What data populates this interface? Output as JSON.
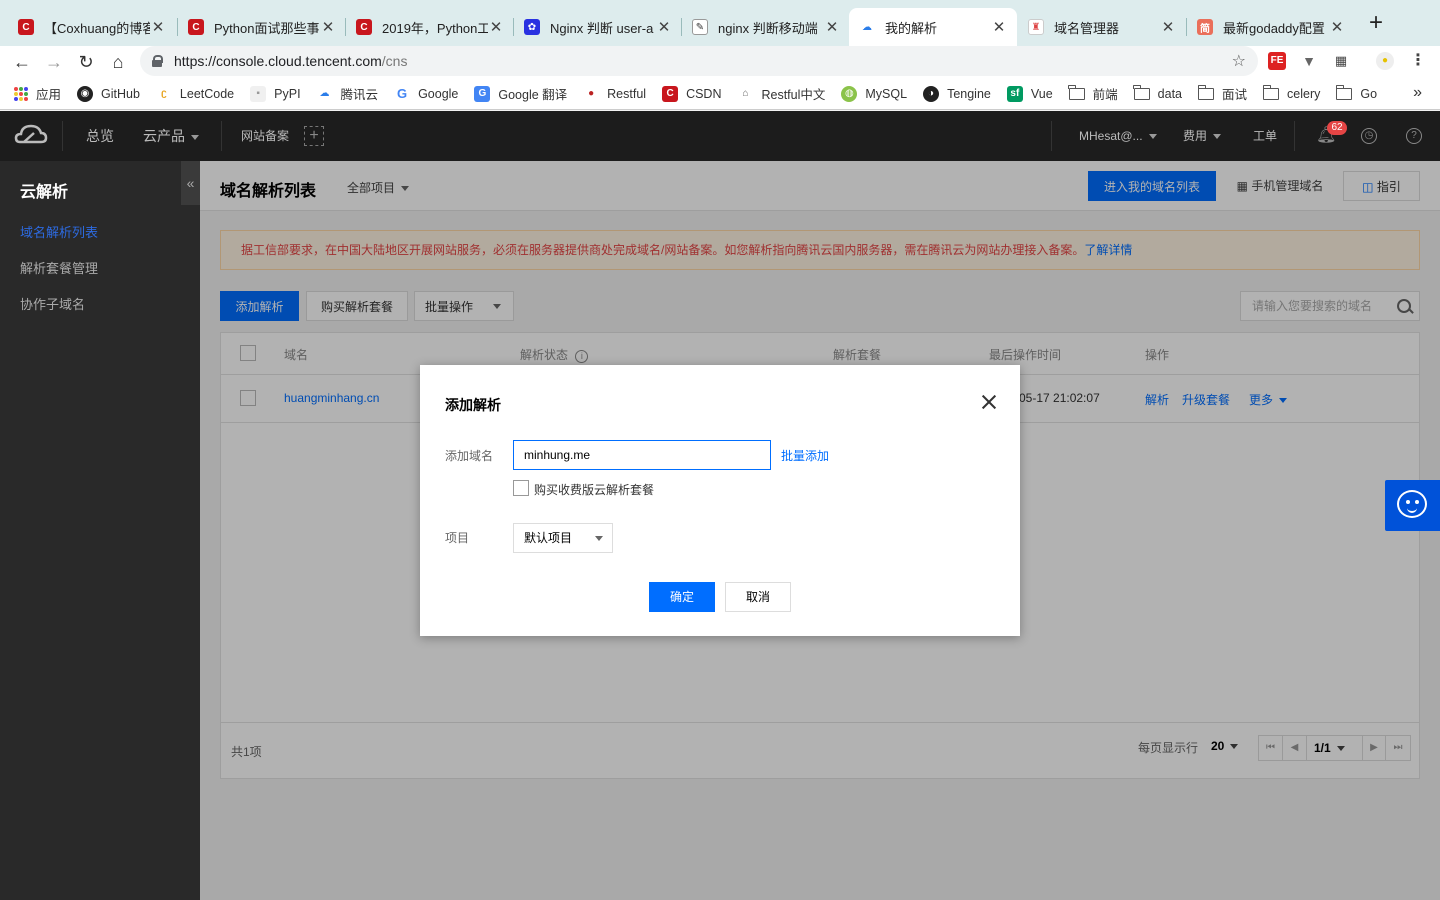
{
  "browser": {
    "tabs": [
      {
        "title": "【Coxhuang的博客",
        "icon": "csdn-icon"
      },
      {
        "title": "Python面试那些事",
        "icon": "csdn-icon"
      },
      {
        "title": "2019年，Python工",
        "icon": "csdn-icon"
      },
      {
        "title": "Nginx 判断 user-a",
        "icon": "baidu-icon"
      },
      {
        "title": "nginx 判断移动端",
        "icon": "page-icon"
      },
      {
        "title": "我的解析",
        "icon": "tencent-cloud-icon",
        "active": true
      },
      {
        "title": "域名管理器",
        "icon": "page-icon"
      },
      {
        "title": "最新godaddy配置",
        "icon": "jianshu-icon"
      }
    ],
    "url_host": "https://console.cloud.tencent.com",
    "url_path": "/cns",
    "bookmarks": [
      "应用",
      "GitHub",
      "LeetCode",
      "PyPI",
      "腾讯云",
      "Google",
      "Google 翻译",
      "Restful",
      "CSDN",
      "Restful中文",
      "MySQL",
      "Tengine",
      "Vue",
      "前端",
      "data",
      "面试",
      "celery",
      "Go"
    ],
    "extensions": {
      "fe": "FE"
    }
  },
  "topbar": {
    "overview": "总览",
    "products": "云产品",
    "beian": "网站备案",
    "account": "MHesat@...",
    "billing": "费用",
    "ticket": "工单",
    "notifications": "62"
  },
  "sidebar": {
    "title": "云解析",
    "items": [
      "域名解析列表",
      "解析套餐管理",
      "协作子域名"
    ]
  },
  "header": {
    "title": "域名解析列表",
    "project_filter": "全部项目",
    "domain_list_button": "进入我的域名列表",
    "mobile_button": "手机管理域名",
    "guide_button": "指引"
  },
  "notice": {
    "text": "据工信部要求，在中国大陆地区开展网站服务，必须在服务器提供商处完成域名/网站备案。如您解析指向腾讯云国内服务器，需在腾讯云为网站办理接入备案。",
    "link": "了解详情"
  },
  "actions": {
    "add": "添加解析",
    "buy": "购买解析套餐",
    "batch": "批量操作",
    "search_placeholder": "请输入您要搜索的域名"
  },
  "table": {
    "columns": [
      "域名",
      "解析状态",
      "解析套餐",
      "最后操作时间",
      "操作"
    ],
    "rows": [
      {
        "domain": "huangminhang.cn",
        "last_op": "05-17 21:02:07",
        "op_resolve": "解析",
        "op_upgrade": "升级套餐",
        "op_more": "更多"
      }
    ],
    "total": "共1项",
    "per_page_label": "每页显示行",
    "per_page": "20",
    "page": "1/1"
  },
  "modal": {
    "title": "添加解析",
    "domain_label": "添加域名",
    "domain_value": "minhung.me",
    "batch_add": "批量添加",
    "buy_paid_label": "购买收费版云解析套餐",
    "project_label": "项目",
    "project_value": "默认项目",
    "ok": "确定",
    "cancel": "取消"
  }
}
